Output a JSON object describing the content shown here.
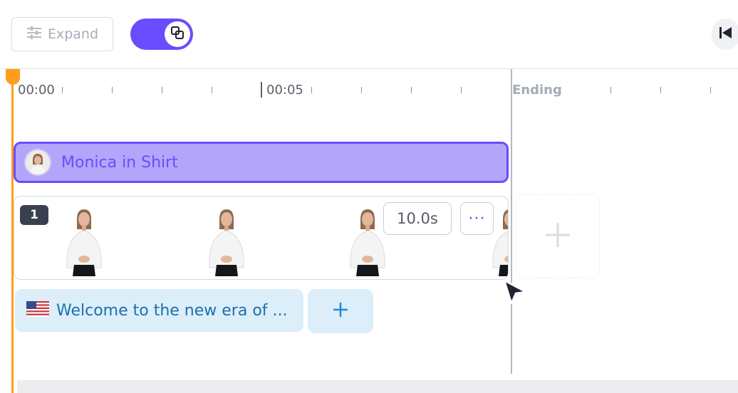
{
  "toolbar": {
    "expand_label": "Expand",
    "toggle_on": true
  },
  "ruler": {
    "start_label": "00:00",
    "mid_label": "00:05",
    "ending_label": "Ending"
  },
  "avatar_track": {
    "label": "Monica in Shirt"
  },
  "scene": {
    "number": "1",
    "duration": "10.0s",
    "more_label": "···"
  },
  "script": {
    "text": "Welcome to the new era of ...",
    "language_flag": "us-flag-icon"
  },
  "colors": {
    "accent": "#6a4cff",
    "playhead": "#ff9d1c",
    "script_bg": "#dbeefa",
    "script_text": "#1f6fa9"
  }
}
